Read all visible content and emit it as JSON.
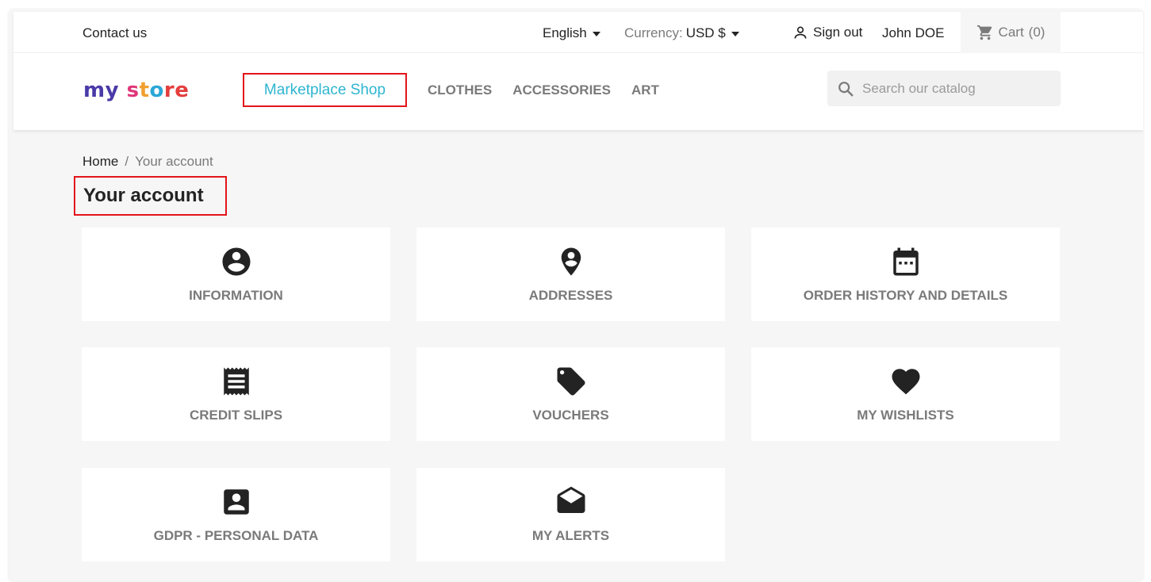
{
  "topbar": {
    "contact_label": "Contact us",
    "language": "English",
    "currency_label": "Currency:",
    "currency_value": "USD $",
    "signout_label": "Sign out",
    "user_name": "John DOE",
    "cart_label": "Cart",
    "cart_count": "(0)"
  },
  "logo": {
    "part1": "my",
    "part2": "s",
    "part3": "t",
    "part4": "o",
    "part5": "re"
  },
  "nav": {
    "marketplace_label": "Marketplace Shop",
    "links": [
      "CLOTHES",
      "ACCESSORIES",
      "ART"
    ]
  },
  "search": {
    "placeholder": "Search our catalog"
  },
  "breadcrumb": {
    "home": "Home",
    "separator": "/",
    "current": "Your account"
  },
  "page": {
    "title": "Your account"
  },
  "tiles": [
    {
      "label": "INFORMATION",
      "icon": "account-circle-icon"
    },
    {
      "label": "ADDRESSES",
      "icon": "location-pin-icon"
    },
    {
      "label": "ORDER HISTORY AND DETAILS",
      "icon": "calendar-icon"
    },
    {
      "label": "CREDIT SLIPS",
      "icon": "receipt-icon"
    },
    {
      "label": "VOUCHERS",
      "icon": "tag-icon"
    },
    {
      "label": "MY WISHLISTS",
      "icon": "heart-icon"
    },
    {
      "label": "GDPR - PERSONAL DATA",
      "icon": "account-box-icon"
    },
    {
      "label": "MY ALERTS",
      "icon": "envelope-open-icon"
    }
  ],
  "colors": {
    "accent": "#2fb5d2",
    "highlight_border": "#e3141b",
    "background": "#f6f6f6",
    "muted_text": "#7a7a7a"
  }
}
